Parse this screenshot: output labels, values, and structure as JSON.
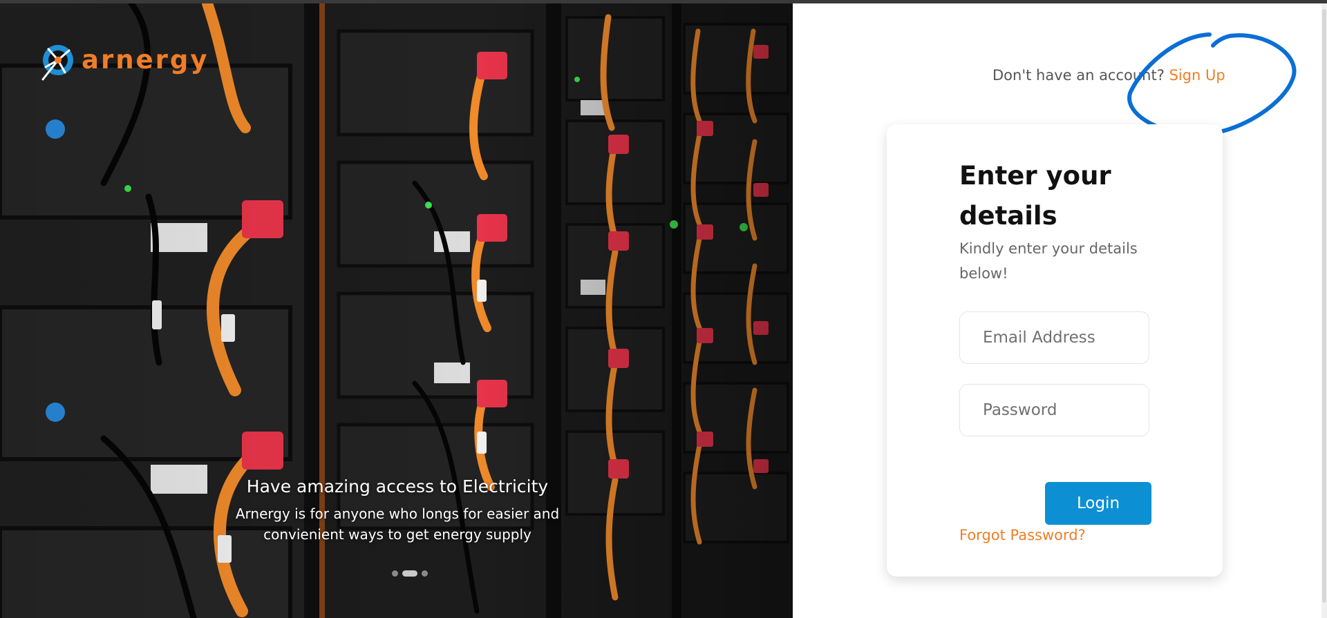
{
  "brand": {
    "name": "arnergy",
    "color": "#f07d27",
    "logo_icon": "arnergy-logo-icon"
  },
  "hero": {
    "image_icon": "battery-rack-photo",
    "title": "Have amazing access to Electricity",
    "subtitle": "Arnergy is for anyone who longs for easier and convienient ways to get energy supply",
    "slides_total": 3,
    "active_slide": 2
  },
  "signup": {
    "prompt": "Don't have an account?",
    "link_label": "Sign Up"
  },
  "login_card": {
    "title": "Enter your details",
    "subtitle": "Kindly enter your details below!",
    "email": {
      "value": "",
      "placeholder": "Email Address"
    },
    "password": {
      "value": "",
      "placeholder": "Password"
    },
    "login_label": "Login",
    "forgot_label": "Forgot Password?"
  },
  "colors": {
    "accent": "#f07d27",
    "primary_button": "#0d8fd4",
    "annotation": "#0b6fd6"
  }
}
